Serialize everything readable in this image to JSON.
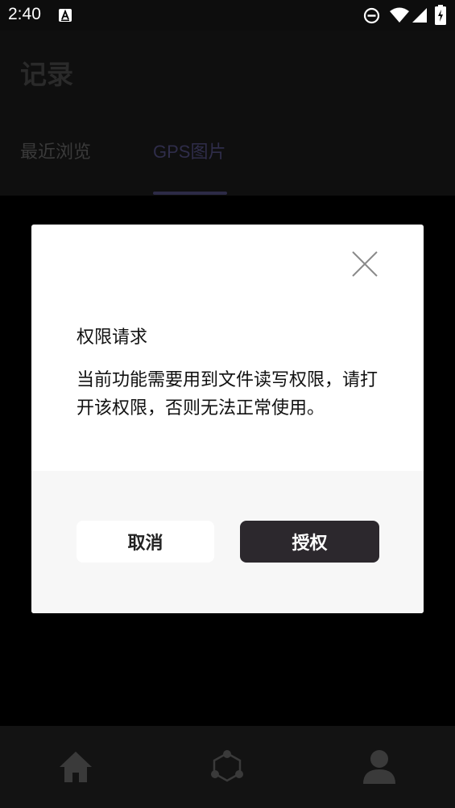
{
  "statusbar": {
    "time": "2:40"
  },
  "header": {
    "title": "记录",
    "tabs": [
      {
        "label": "最近浏览",
        "active": false
      },
      {
        "label": "GPS图片",
        "active": true
      }
    ]
  },
  "dialog": {
    "title": "权限请求",
    "message": "当前功能需要用到文件读写权限，请打开该权限，否则无法正常使用。",
    "cancel_label": "取消",
    "grant_label": "授权"
  },
  "bottom_nav": {
    "items": [
      {
        "icon": "home-icon"
      },
      {
        "icon": "hexagon-network-icon"
      },
      {
        "icon": "user-icon"
      }
    ]
  },
  "colors": {
    "dialog_bg": "#ffffff",
    "footer_bg": "#f7f7f7",
    "primary_button": "#2c282d",
    "tab_indicator": "#2c2a46"
  }
}
